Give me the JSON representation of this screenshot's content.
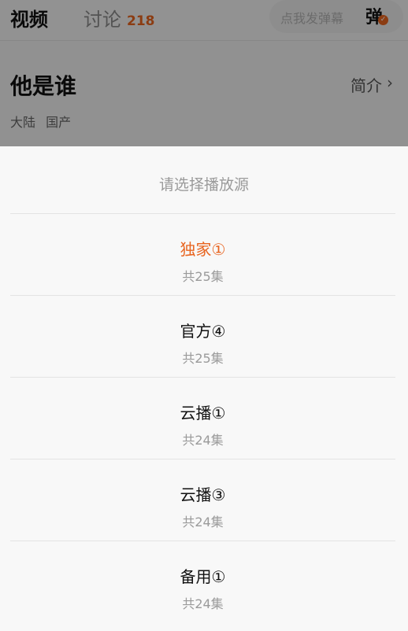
{
  "header": {
    "tab_video": "视频",
    "tab_discuss": "讨论",
    "discuss_count": "218",
    "danmaku_placeholder": "点我发弹幕",
    "danmaku_toggle": "弹"
  },
  "show": {
    "title": "他是谁",
    "intro_label": "简介",
    "tags": [
      "大陆",
      "国产"
    ]
  },
  "source_sheet": {
    "title": "请选择播放源",
    "accent_color": "#e8641f",
    "selected_index": 0,
    "sources": [
      {
        "name": "独家①",
        "count": "共25集"
      },
      {
        "name": "官方④",
        "count": "共25集"
      },
      {
        "name": "云播①",
        "count": "共24集"
      },
      {
        "name": "云播③",
        "count": "共24集"
      },
      {
        "name": "备用①",
        "count": "共24集"
      }
    ]
  }
}
